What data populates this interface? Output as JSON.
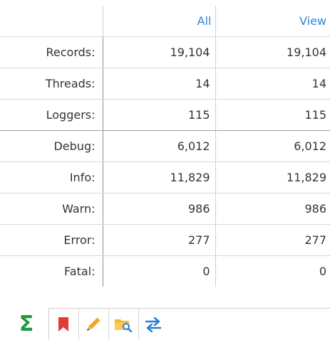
{
  "columns": {
    "all": "All",
    "view": "View"
  },
  "rows": [
    {
      "label": "Records:",
      "all": "19,104",
      "view": "19,104"
    },
    {
      "label": "Threads:",
      "all": "14",
      "view": "14"
    },
    {
      "label": "Loggers:",
      "all": "115",
      "view": "115"
    },
    {
      "label": "Debug:",
      "all": "6,012",
      "view": "6,012"
    },
    {
      "label": "Info:",
      "all": "11,829",
      "view": "11,829"
    },
    {
      "label": "Warn:",
      "all": "986",
      "view": "986"
    },
    {
      "label": "Error:",
      "all": "277",
      "view": "277"
    },
    {
      "label": "Fatal:",
      "all": "0",
      "view": "0"
    }
  ],
  "tabs": [
    {
      "icon": "sigma-icon",
      "glyph": "Σ",
      "active": true
    },
    {
      "icon": "bookmark-icon",
      "active": false
    },
    {
      "icon": "pencil-icon",
      "active": false
    },
    {
      "icon": "folder-search-icon",
      "active": false
    },
    {
      "icon": "swap-arrows-icon",
      "active": false
    }
  ],
  "colors": {
    "accent": "#2f86d6",
    "sigma": "#1e9a3c",
    "bookmark": "#e23a3a",
    "pencil": "#f2a227",
    "folder": "#f3b82d",
    "swap": "#2a7fd4"
  }
}
